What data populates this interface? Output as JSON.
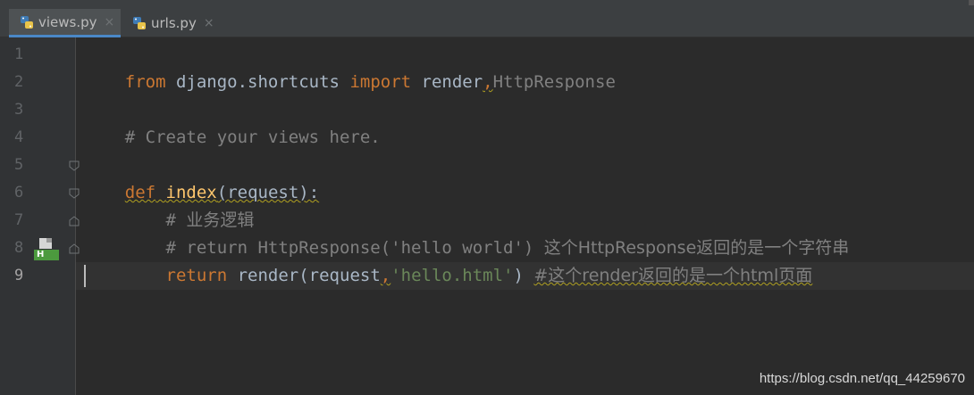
{
  "tabs": [
    {
      "label": "views.py",
      "close": "×",
      "active": true,
      "icon": "python-file-icon"
    },
    {
      "label": "urls.py",
      "close": "×",
      "active": false,
      "icon": "python-file-icon"
    }
  ],
  "gutter": {
    "line_numbers": [
      "1",
      "2",
      "3",
      "4",
      "5",
      "6",
      "7",
      "8",
      "9"
    ],
    "current_line": "9",
    "line8_marker": "H"
  },
  "code": {
    "line1": {
      "from": "from",
      "module": " django.shortcuts ",
      "import": "import",
      "names": " render",
      "comma": ",",
      "unused": "HttpResponse"
    },
    "line3": {
      "comment": "# Create your views here."
    },
    "line5": {
      "def": "def",
      "space": " ",
      "name": "index",
      "params": "(request):"
    },
    "line6": {
      "comment_hash": "    # ",
      "comment_text": "业务逻辑"
    },
    "line7": {
      "comment_code": "    # return HttpResponse('hello world') ",
      "comment_cjk": "这个HttpResponse返回的是一个字符串"
    },
    "line8": {
      "indent": "    ",
      "return": "return",
      "call": " render(request",
      "comma": ",",
      "arg": "'hello.html'",
      "close": ") ",
      "comment": "#这个render返回的是一个html页面"
    }
  },
  "watermark": "https://blog.csdn.net/qq_44259670",
  "colors": {
    "background": "#2b2b2b",
    "keyword": "#cc7832",
    "function": "#ffc66d",
    "string": "#6a8759",
    "comment": "#808080",
    "text": "#a9b7c6",
    "tab_accent": "#4a88c7"
  }
}
